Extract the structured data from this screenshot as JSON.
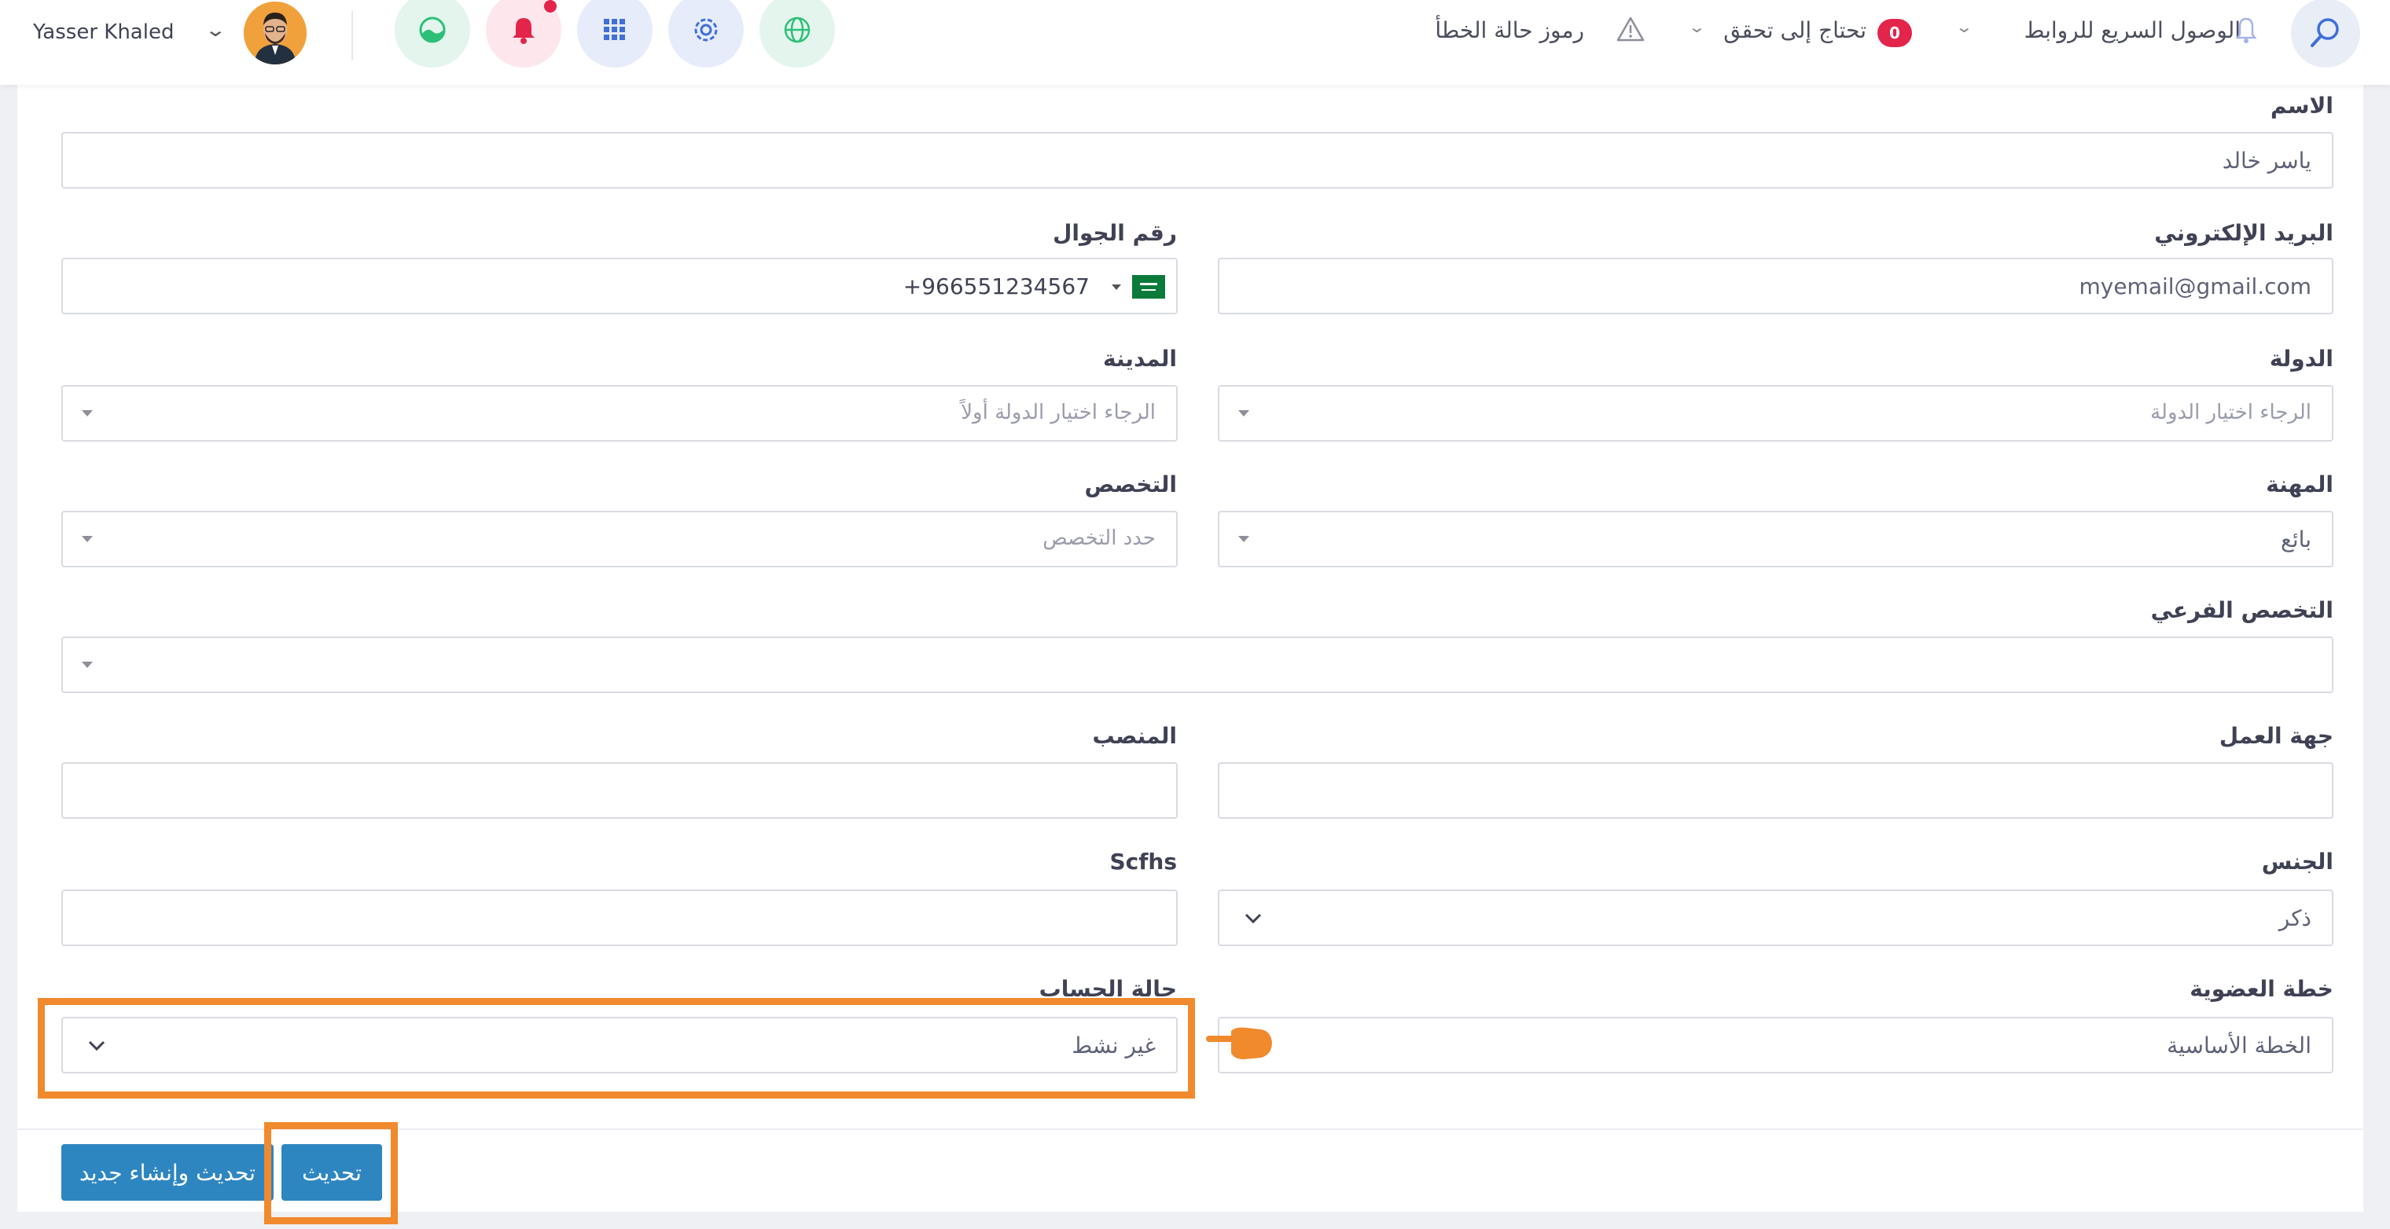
{
  "header": {
    "user_name": "Yasser Khaled",
    "error_codes_label": "رموز حالة الخطأ",
    "needs_verification_label": "تحتاج إلى تحقق",
    "needs_verification_count": "0",
    "quick_links_label": "الوصول السريع للروابط",
    "icons": [
      "globe-icon",
      "settings-icon",
      "apps-grid-icon",
      "bell-icon",
      "analytics-icon",
      "search-icon"
    ],
    "colors": {
      "notification": "#e3244b",
      "green": "#2dbf78",
      "blue": "#3f6fd8"
    }
  },
  "form": {
    "name": {
      "label": "الاسم",
      "value": "ياسر خالد"
    },
    "email": {
      "label": "البريد الإلكتروني",
      "value": "myemail@gmail.com"
    },
    "phone": {
      "label": "رقم الجوال",
      "value": "+966551234567"
    },
    "country": {
      "label": "الدولة",
      "placeholder": "الرجاء اختيار الدولة"
    },
    "city": {
      "label": "المدينة",
      "placeholder": "الرجاء اختيار الدولة أولاً"
    },
    "profession": {
      "label": "المهنة",
      "value": "بائع"
    },
    "specialty": {
      "label": "التخصص",
      "placeholder": "حدد التخصص"
    },
    "subspecialty": {
      "label": "التخصص الفرعي",
      "value": ""
    },
    "workplace": {
      "label": "جهة العمل",
      "value": ""
    },
    "position": {
      "label": "المنصب",
      "value": ""
    },
    "gender": {
      "label": "الجنس",
      "value": "ذكر"
    },
    "scfhs": {
      "label": "Scfhs",
      "value": ""
    },
    "membership_plan": {
      "label": "خطة العضوية",
      "value": "الخطة الأساسية"
    },
    "account_status": {
      "label": "حالة الحساب",
      "value": "غير نشط"
    }
  },
  "actions": {
    "update_label": "تحديث",
    "update_and_new_label": "تحديث وإنشاء جديد",
    "button_color": "#2e86c1",
    "highlight_color": "#f08a2c"
  }
}
